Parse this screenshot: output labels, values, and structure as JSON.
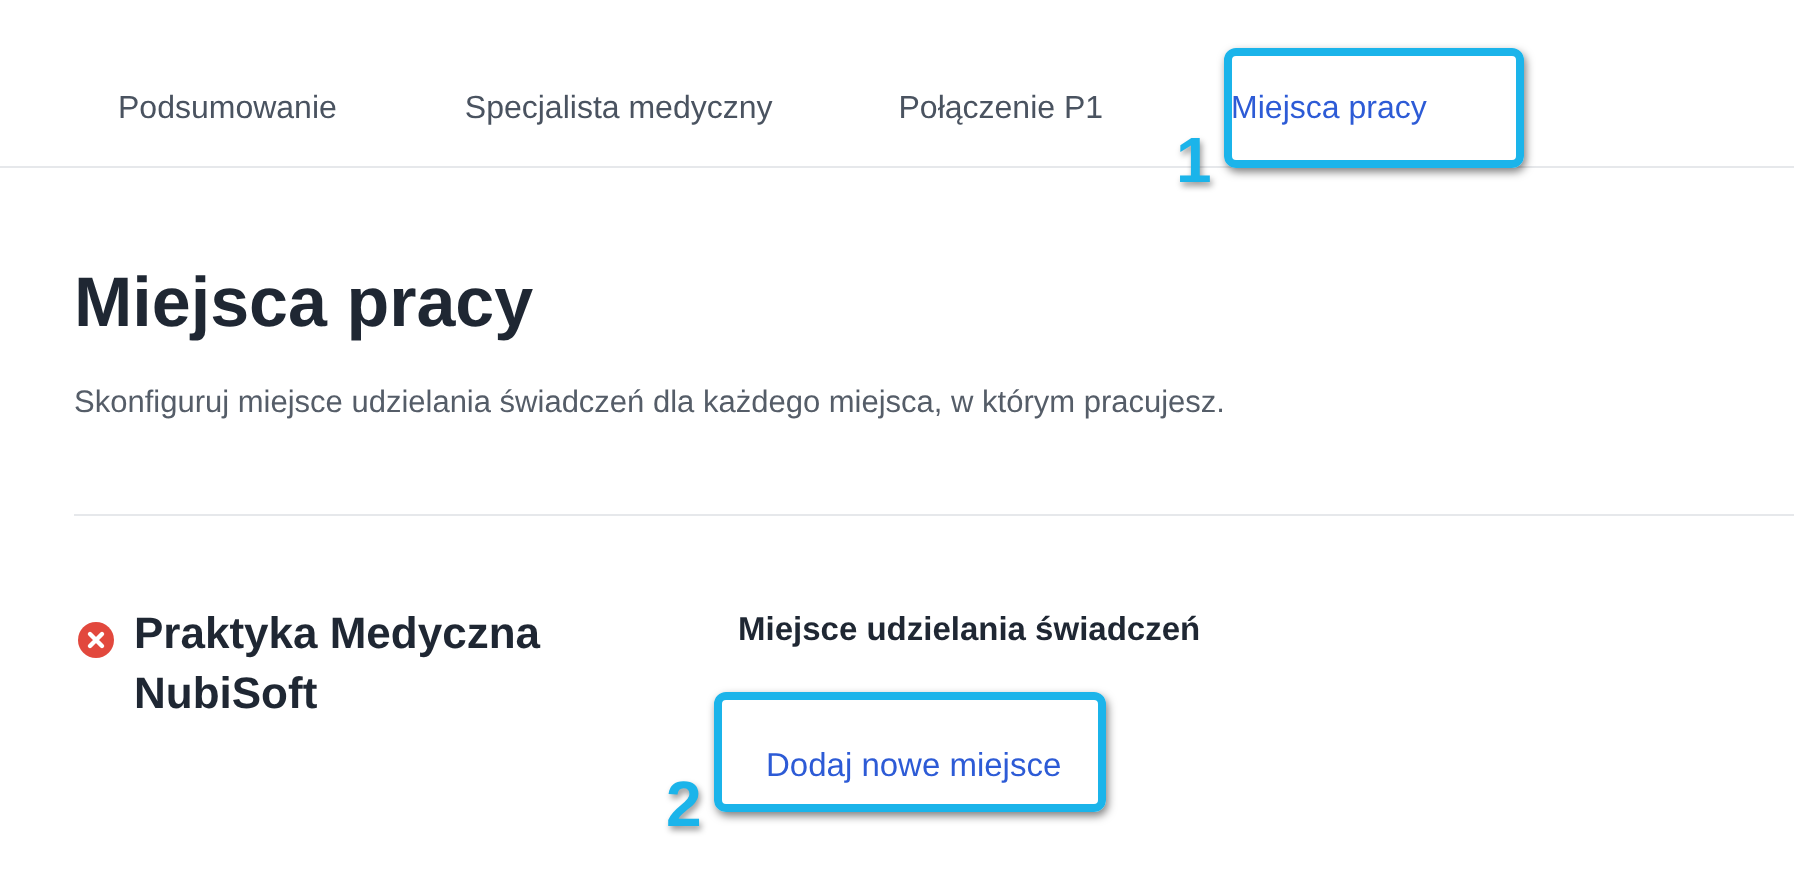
{
  "tabs": [
    {
      "label": "Podsumowanie",
      "selected": false
    },
    {
      "label": "Specjalista medyczny",
      "selected": false
    },
    {
      "label": "Połączenie P1",
      "selected": false
    },
    {
      "label": "Miejsca pracy",
      "selected": true
    }
  ],
  "heading": "Miejsca pracy",
  "description": "Skonfiguruj miejsce udzielania świadczeń dla każdego miejsca, w którym pracujesz.",
  "workplaces": [
    {
      "name": "Praktyka Medyczna NubiSoft",
      "valid": false,
      "section_title": "Miejsce udzielania świadczeń",
      "add_link": "Dodaj nowe miejsce"
    }
  ],
  "annotations": [
    {
      "number": "1"
    },
    {
      "number": "2"
    }
  ]
}
